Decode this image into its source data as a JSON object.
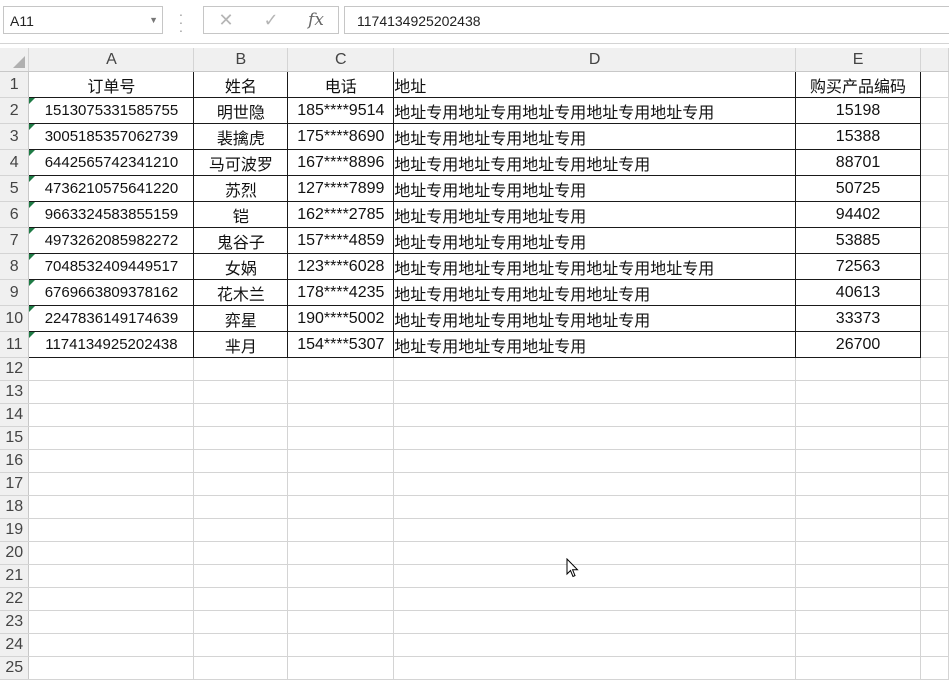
{
  "formula_bar": {
    "name_box": "A11",
    "cancel_icon": "✕",
    "enter_icon": "✓",
    "fx_label": "fx",
    "formula_value": "1174134925202438"
  },
  "columns": [
    "A",
    "B",
    "C",
    "D",
    "E"
  ],
  "header_row": {
    "row_number": "1",
    "cells": [
      "订单号",
      "姓名",
      "电话",
      "地址",
      "购买产品编码"
    ]
  },
  "rows": [
    {
      "row_number": "2",
      "order": "1513075331585755",
      "name": "明世隐",
      "phone": "185****9514",
      "address": "地址专用地址专用地址专用地址专用地址专用",
      "code": "15198"
    },
    {
      "row_number": "3",
      "order": "3005185357062739",
      "name": "裴擒虎",
      "phone": "175****8690",
      "address": "地址专用地址专用地址专用",
      "code": "15388"
    },
    {
      "row_number": "4",
      "order": "6442565742341210",
      "name": "马可波罗",
      "phone": "167****8896",
      "address": "地址专用地址专用地址专用地址专用",
      "code": "88701"
    },
    {
      "row_number": "5",
      "order": "4736210575641220",
      "name": "苏烈",
      "phone": "127****7899",
      "address": "地址专用地址专用地址专用",
      "code": "50725"
    },
    {
      "row_number": "6",
      "order": "9663324583855159",
      "name": "铠",
      "phone": "162****2785",
      "address": "地址专用地址专用地址专用",
      "code": "94402"
    },
    {
      "row_number": "7",
      "order": "4973262085982272",
      "name": "鬼谷子",
      "phone": "157****4859",
      "address": "地址专用地址专用地址专用",
      "code": "53885"
    },
    {
      "row_number": "8",
      "order": "7048532409449517",
      "name": "女娲",
      "phone": "123****6028",
      "address": "地址专用地址专用地址专用地址专用地址专用",
      "code": "72563"
    },
    {
      "row_number": "9",
      "order": "6769663809378162",
      "name": "花木兰",
      "phone": "178****4235",
      "address": "地址专用地址专用地址专用地址专用",
      "code": "40613"
    },
    {
      "row_number": "10",
      "order": "2247836149174639",
      "name": "弈星",
      "phone": "190****5002",
      "address": "地址专用地址专用地址专用地址专用",
      "code": "33373"
    },
    {
      "row_number": "11",
      "order": "1174134925202438",
      "name": "芈月",
      "phone": "154****5307",
      "address": "地址专用地址专用地址专用",
      "code": "26700"
    }
  ],
  "empty_rows": [
    "12",
    "13",
    "14",
    "15",
    "16",
    "17",
    "18",
    "19",
    "20",
    "21",
    "22",
    "23",
    "24",
    "25"
  ],
  "colors": {
    "border": "#1a1a1a",
    "gridline": "#d4d4d4",
    "header_bg": "#f0f0f0",
    "text_indicator": "#1e7b45"
  }
}
